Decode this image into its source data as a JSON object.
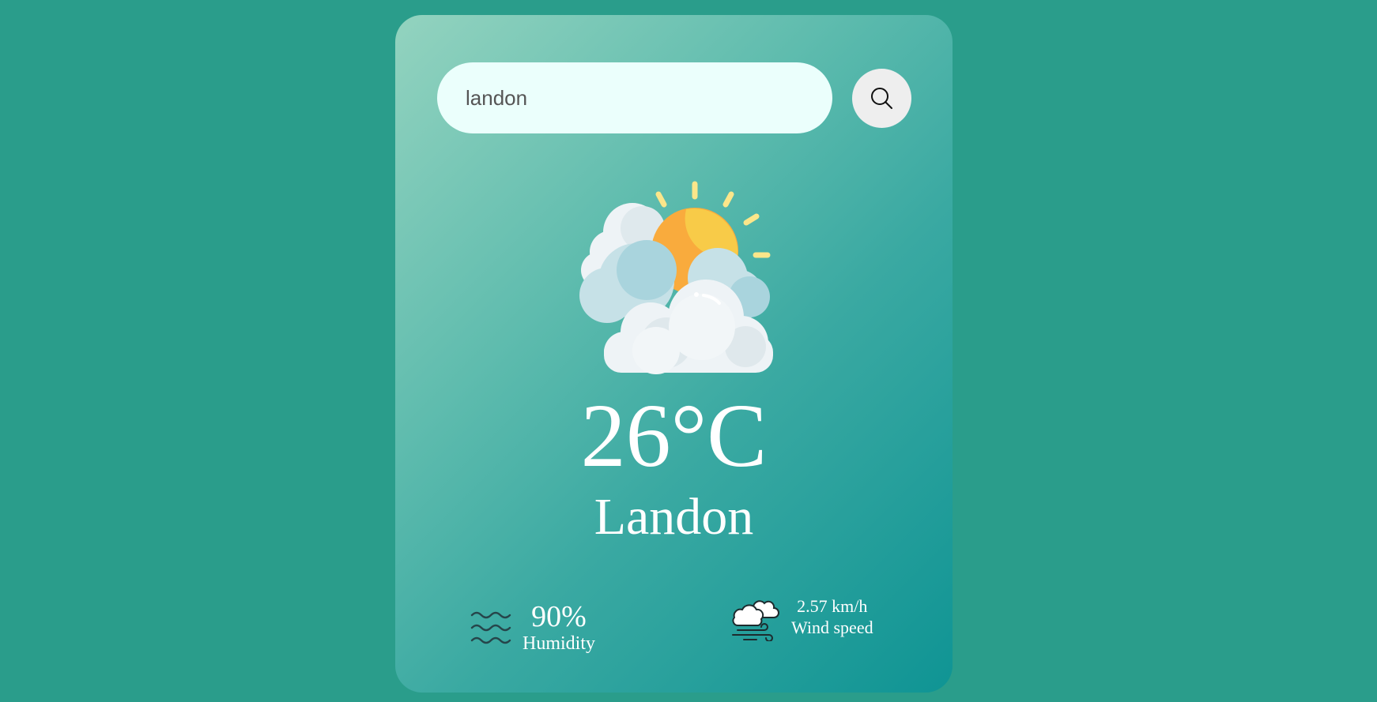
{
  "search": {
    "value": "landon",
    "icon": "search-icon"
  },
  "weather": {
    "icon": "partly-cloudy-sun-icon",
    "temperature": "26°C",
    "city": "Landon"
  },
  "humidity": {
    "icon": "water-waves-icon",
    "value": "90%",
    "label": "Humidity"
  },
  "wind": {
    "icon": "wind-cloud-icon",
    "value": "2.57 km/h",
    "label": "Wind speed"
  },
  "colors": {
    "page_background": "#2a9d8b",
    "card_gradient_start": "#93d3bf",
    "card_gradient_end": "#0f9494",
    "input_background": "#ebfffc",
    "button_background": "#eeeeee",
    "sun_orange": "#f9a93f",
    "sun_yellow": "#f8c948"
  }
}
